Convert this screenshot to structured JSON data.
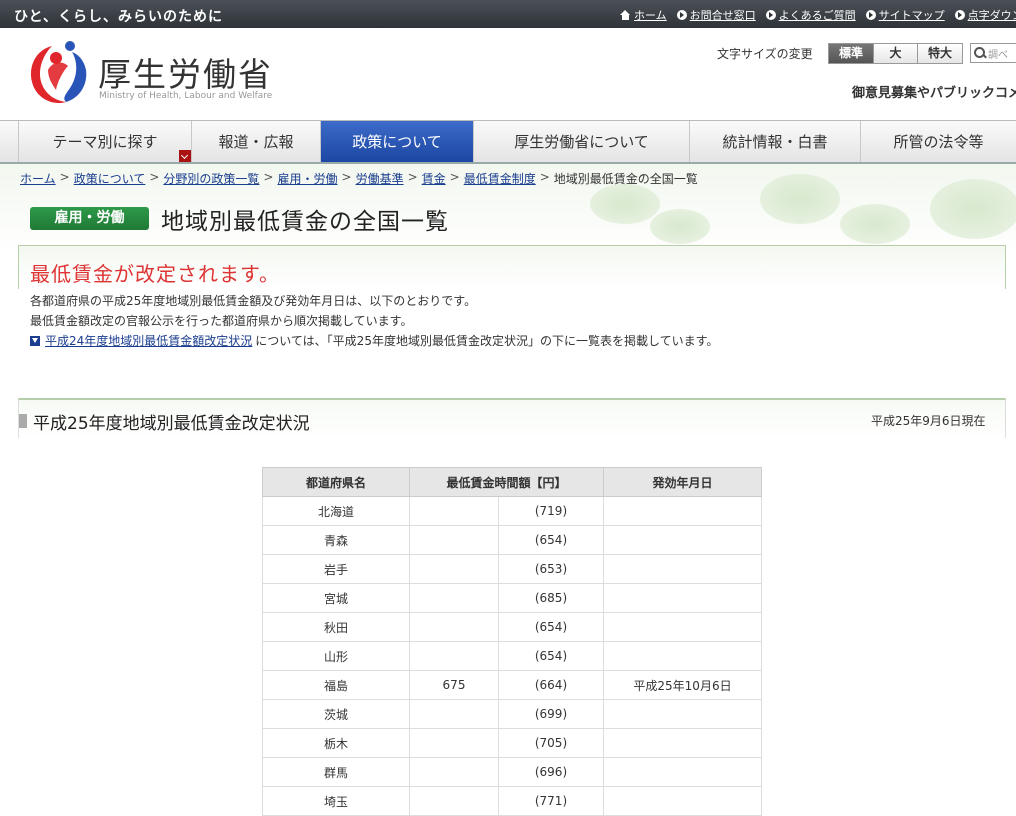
{
  "topbar": {
    "tagline": "ひと、くらし、みらいのために",
    "links": [
      "ホーム",
      "お問合せ窓口",
      "よくあるご質問",
      "サイトマップ",
      "点字ダウンロード"
    ]
  },
  "header": {
    "logo_title": "厚生労働省",
    "logo_subtitle": "Ministry of Health, Labour and Welfare",
    "fontsize_label": "文字サイズの変更",
    "fontsize_options": [
      "標準",
      "大",
      "特大"
    ],
    "search_placeholder": "調べ",
    "opinion_text": "御意見募集やパブリックコメント"
  },
  "nav": {
    "items": [
      "テーマ別に探す",
      "報道・広報",
      "政策について",
      "厚生労働省について",
      "統計情報・白書",
      "所管の法令等"
    ]
  },
  "breadcrumb": {
    "items": [
      "ホーム",
      "政策について",
      "分野別の政策一覧",
      "雇用・労働",
      "労働基準",
      "賃金",
      "最低賃金制度"
    ],
    "current": "地域別最低賃金の全国一覧"
  },
  "page": {
    "category": "雇用・労働",
    "title": "地域別最低賃金の全国一覧"
  },
  "notice": {
    "title": "最低賃金が改定されます。",
    "line1": "各都道府県の平成25年度地域別最低賃金額及び発効年月日は、以下のとおりです。",
    "line2": "最低賃金額改定の官報公示を行った都道府県から順次掲載しています。",
    "link": "平成24年度地域別最低賃金額改定状況",
    "link_suffix": "については、「平成25年度地域別最低賃金改定状況」の下に一覧表を掲載しています。"
  },
  "section": {
    "title": "平成25年度地域別最低賃金改定状況",
    "asof": "平成25年9月6日現在"
  },
  "table": {
    "headers": [
      "都道府県名",
      "最低賃金時間額【円】",
      "発効年月日"
    ],
    "rows": [
      {
        "pref": "北海道",
        "new": "",
        "old": "(719)",
        "date": ""
      },
      {
        "pref": "青森",
        "new": "",
        "old": "(654)",
        "date": ""
      },
      {
        "pref": "岩手",
        "new": "",
        "old": "(653)",
        "date": ""
      },
      {
        "pref": "宮城",
        "new": "",
        "old": "(685)",
        "date": ""
      },
      {
        "pref": "秋田",
        "new": "",
        "old": "(654)",
        "date": ""
      },
      {
        "pref": "山形",
        "new": "",
        "old": "(654)",
        "date": ""
      },
      {
        "pref": "福島",
        "new": "675",
        "old": "(664)",
        "date": "平成25年10月6日"
      },
      {
        "pref": "茨城",
        "new": "",
        "old": "(699)",
        "date": ""
      },
      {
        "pref": "栃木",
        "new": "",
        "old": "(705)",
        "date": ""
      },
      {
        "pref": "群馬",
        "new": "",
        "old": "(696)",
        "date": ""
      },
      {
        "pref": "埼玉",
        "new": "",
        "old": "(771)",
        "date": ""
      }
    ]
  }
}
